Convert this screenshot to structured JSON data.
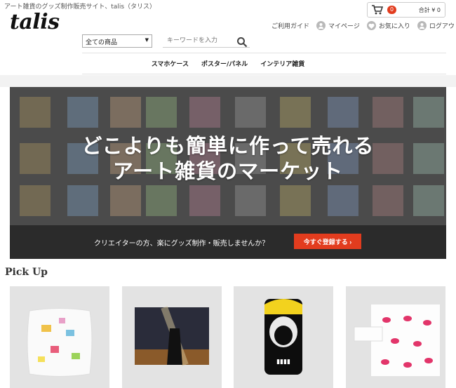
{
  "header": {
    "tagline": "アート雑貨のグッズ制作販売サイト、talis（タリス）",
    "logo": "talis",
    "cart": {
      "badge": "0",
      "total": "合計 ¥ 0"
    },
    "nav": {
      "guide": "ご利用ガイド",
      "mypage": "マイページ",
      "favorites": "お気に入り",
      "logout": "ログアウト"
    },
    "search": {
      "category": "全ての商品",
      "placeholder": "キーワードを入力"
    }
  },
  "categories": [
    "スマホケース",
    "ポスター/パネル",
    "インテリア雑貨"
  ],
  "hero": {
    "line1": "どこよりも簡単に作って売れる",
    "line2": "アート雑貨のマーケット",
    "cta_text": "クリエイターの方、楽にグッズ制作・販売しませんか？",
    "cta_button": "今すぐ登録する ›"
  },
  "pickup": {
    "title": "Pick Up",
    "items": [
      {
        "name": "cushion"
      },
      {
        "name": "poster"
      },
      {
        "name": "phone-case"
      },
      {
        "name": "notebook-case"
      }
    ]
  },
  "colors": {
    "accent": "#e23c1e",
    "dark": "#2b2b2b"
  }
}
